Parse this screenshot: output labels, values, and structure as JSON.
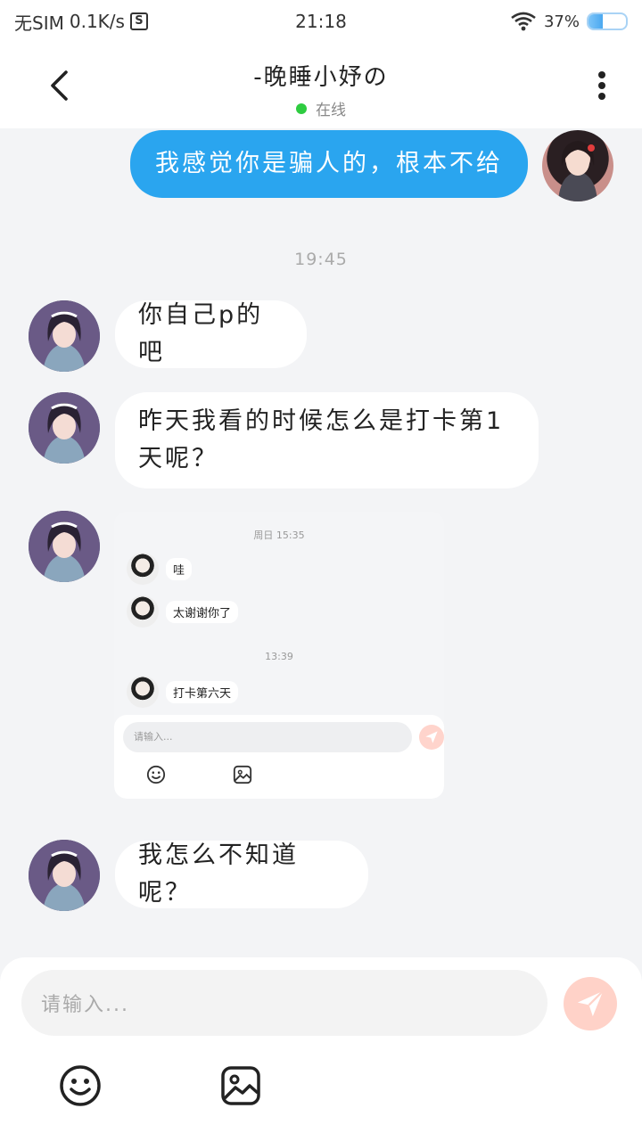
{
  "status_bar": {
    "carrier": "无SIM",
    "speed": "0.1K/s",
    "s_icon": "S",
    "time": "21:18",
    "battery": "37%",
    "battery_level": 0.37
  },
  "header": {
    "title": "-晚睡小妤の",
    "status": "在线"
  },
  "messages": {
    "m1": "我感觉你是骗人的，根本不给",
    "time1": "19:45",
    "m2": "你自己p的吧",
    "m3_line1": "昨天我看的时候怎么是打卡第1",
    "m3_line2": "天呢？",
    "m4": "我怎么不知道呢？"
  },
  "screenshot": {
    "time_a": "周日 15:35",
    "msg_a": "哇",
    "msg_b": "太谢谢你了",
    "time_b": "13:39",
    "msg_c": "打卡第六天",
    "placeholder": "请输入..."
  },
  "composer": {
    "placeholder": "请输入..."
  },
  "colors": {
    "accent": "#2aa5ef",
    "send_inactive": "#ffd2c8",
    "online": "#2ecc40"
  }
}
